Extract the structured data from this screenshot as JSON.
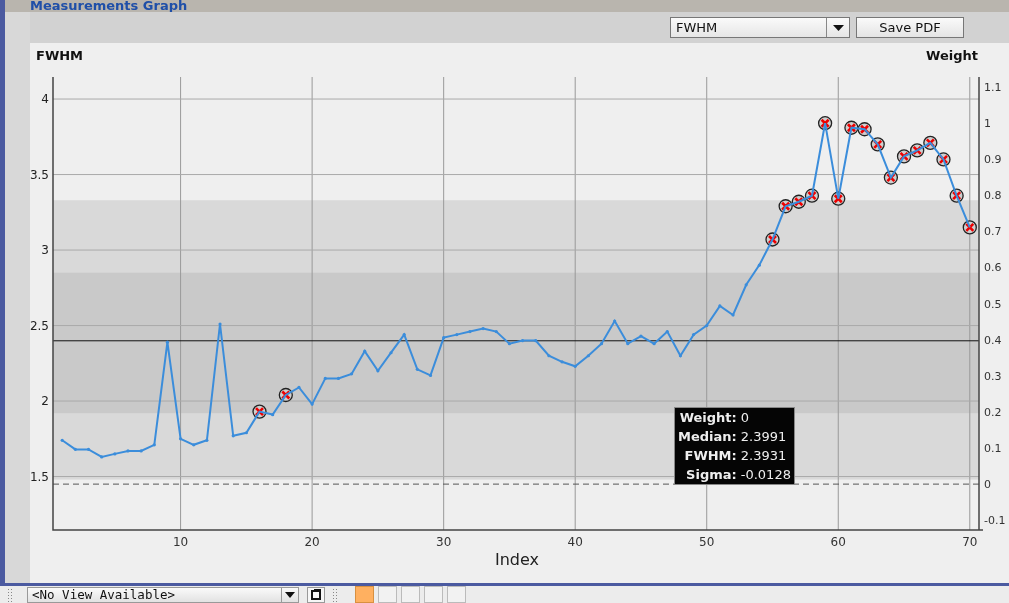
{
  "window": {
    "title": "Measurements Graph"
  },
  "toolbar": {
    "metric": "FWHM",
    "save_button": "Save PDF"
  },
  "chart": {
    "chart_data": {
      "type": "line",
      "ylabel": "FWHM",
      "y2label": "Weight",
      "xlabel": "Index",
      "grid": true,
      "x": [
        1,
        2,
        3,
        4,
        5,
        6,
        7,
        8,
        9,
        10,
        11,
        12,
        13,
        14,
        15,
        16,
        17,
        18,
        19,
        20,
        21,
        22,
        23,
        24,
        25,
        26,
        27,
        28,
        29,
        30,
        31,
        32,
        33,
        34,
        35,
        36,
        37,
        38,
        39,
        40,
        41,
        42,
        43,
        44,
        45,
        46,
        47,
        48,
        49,
        50,
        51,
        52,
        53,
        54,
        55,
        56,
        57,
        58,
        59,
        60,
        61,
        62,
        63,
        64,
        65,
        66,
        67,
        68,
        69,
        70
      ],
      "xlim": [
        0.3,
        70.7
      ],
      "ylim": [
        1.146,
        4.146
      ],
      "y2lim": [
        -0.127,
        1.127
      ],
      "xticks": [
        10,
        20,
        30,
        40,
        50,
        60,
        70
      ],
      "yticks": [
        1.5,
        2,
        2.5,
        3,
        3.5,
        4
      ],
      "y2ticks": [
        -0.1,
        0,
        0.1,
        0.2,
        0.3,
        0.4,
        0.5,
        0.6,
        0.7,
        0.8,
        0.9,
        1,
        1.1
      ],
      "series": [
        {
          "color": "#3b8ddb",
          "values": [
            1.74,
            1.68,
            1.68,
            1.63,
            1.65,
            1.67,
            1.67,
            1.71,
            2.39,
            1.75,
            1.71,
            1.74,
            2.51,
            1.77,
            1.79,
            1.93,
            1.91,
            2.04,
            2.09,
            1.98,
            2.15,
            2.15,
            2.18,
            2.33,
            2.2,
            2.32,
            2.44,
            2.21,
            2.17,
            2.42,
            2.44,
            2.46,
            2.48,
            2.46,
            2.38,
            2.4,
            2.4,
            2.3,
            2.26,
            2.23,
            2.3,
            2.38,
            2.53,
            2.38,
            2.43,
            2.38,
            2.46,
            2.3,
            2.44,
            2.5,
            2.63,
            2.57,
            2.77,
            2.9,
            3.07,
            3.29,
            3.32,
            3.36,
            3.84,
            3.34,
            3.81,
            3.8,
            3.7,
            3.48,
            3.62,
            3.66,
            3.71,
            3.6,
            3.36,
            3.15
          ]
        }
      ],
      "bands": [
        {
          "axis": "y",
          "from": 1.48,
          "to": 3.33
        },
        {
          "axis": "y",
          "from": 1.92,
          "to": 2.85
        }
      ],
      "ref_lines": [
        {
          "axis": "y",
          "value": 2.3991
        },
        {
          "axis": "y2",
          "value": 0
        }
      ]
    },
    "points": [
      {
        "excluded": false
      },
      {
        "excluded": false
      },
      {
        "excluded": false
      },
      {
        "excluded": false
      },
      {
        "excluded": false
      },
      {
        "excluded": false
      },
      {
        "excluded": false
      },
      {
        "excluded": false
      },
      {
        "excluded": false
      },
      {
        "excluded": false
      },
      {
        "excluded": false
      },
      {
        "excluded": false
      },
      {
        "excluded": false
      },
      {
        "excluded": false
      },
      {
        "excluded": false
      },
      {
        "excluded": true
      },
      {
        "excluded": false
      },
      {
        "excluded": true
      },
      {
        "excluded": false
      },
      {
        "excluded": false
      },
      {
        "excluded": false
      },
      {
        "excluded": false
      },
      {
        "excluded": false
      },
      {
        "excluded": false
      },
      {
        "excluded": false
      },
      {
        "excluded": false
      },
      {
        "excluded": false
      },
      {
        "excluded": false
      },
      {
        "excluded": false
      },
      {
        "excluded": false
      },
      {
        "excluded": false
      },
      {
        "excluded": false
      },
      {
        "excluded": false
      },
      {
        "excluded": false
      },
      {
        "excluded": false
      },
      {
        "excluded": false
      },
      {
        "excluded": false
      },
      {
        "excluded": false
      },
      {
        "excluded": false
      },
      {
        "excluded": false
      },
      {
        "excluded": false
      },
      {
        "excluded": false
      },
      {
        "excluded": false
      },
      {
        "excluded": false
      },
      {
        "excluded": false
      },
      {
        "excluded": false
      },
      {
        "excluded": false
      },
      {
        "excluded": false
      },
      {
        "excluded": false
      },
      {
        "excluded": false
      },
      {
        "excluded": false
      },
      {
        "excluded": false
      },
      {
        "excluded": false
      },
      {
        "excluded": false
      },
      {
        "excluded": true
      },
      {
        "excluded": true
      },
      {
        "excluded": true
      },
      {
        "excluded": true
      },
      {
        "excluded": true
      },
      {
        "excluded": true
      },
      {
        "excluded": true
      },
      {
        "excluded": true
      },
      {
        "excluded": true
      },
      {
        "excluded": true
      },
      {
        "excluded": true
      },
      {
        "excluded": true
      },
      {
        "excluded": true
      },
      {
        "excluded": true
      },
      {
        "excluded": true
      },
      {
        "excluded": true
      }
    ]
  },
  "tooltip": {
    "rows": [
      {
        "label": "Weight:",
        "value": "0"
      },
      {
        "label": "Median:",
        "value": "2.3991"
      },
      {
        "label": "FWHM:",
        "value": "2.3931"
      },
      {
        "label": "Sigma:",
        "value": "-0.0128"
      }
    ]
  },
  "bottom_bar": {
    "view_selector": "<No View Available>",
    "view_slots": [
      {
        "selected": true
      },
      {
        "selected": false
      },
      {
        "selected": false
      },
      {
        "selected": false
      },
      {
        "selected": false
      }
    ]
  }
}
